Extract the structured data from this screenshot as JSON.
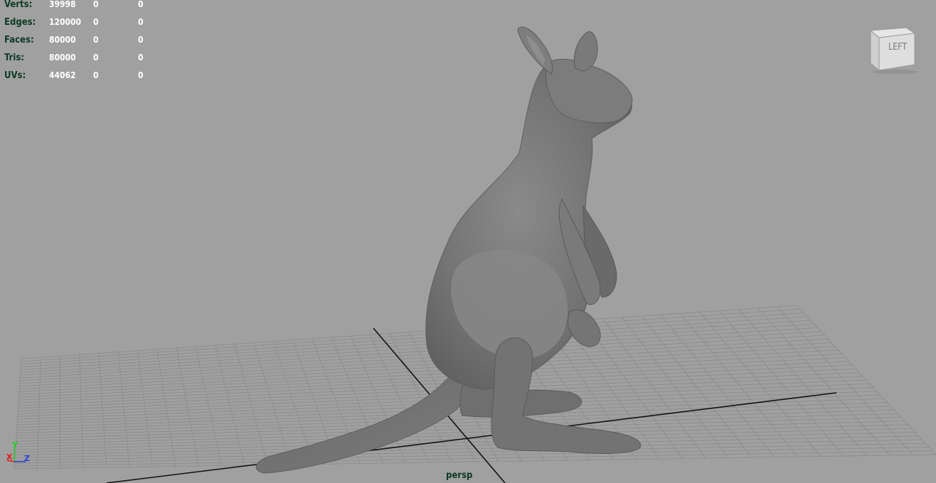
{
  "hud": {
    "rows": [
      {
        "label": "Verts:",
        "values": [
          "39998",
          "0",
          "0"
        ]
      },
      {
        "label": "Edges:",
        "values": [
          "120000",
          "0",
          "0"
        ]
      },
      {
        "label": "Faces:",
        "values": [
          "80000",
          "0",
          "0"
        ]
      },
      {
        "label": "Tris:",
        "values": [
          "80000",
          "0",
          "0"
        ]
      },
      {
        "label": "UVs:",
        "values": [
          "44062",
          "0",
          "0"
        ]
      }
    ]
  },
  "viewcube": {
    "label": "LEFT"
  },
  "axis": {
    "x": "X",
    "y": "Y",
    "z": "Z"
  },
  "camera": {
    "name": "persp"
  },
  "colors": {
    "viewport_bg": "#a0a0a0",
    "grid_line": "#8a8a8a",
    "grid_axis": "#111111",
    "model": "#707070",
    "hud_label": "#0e3a24",
    "hud_value": "#ffffff"
  }
}
